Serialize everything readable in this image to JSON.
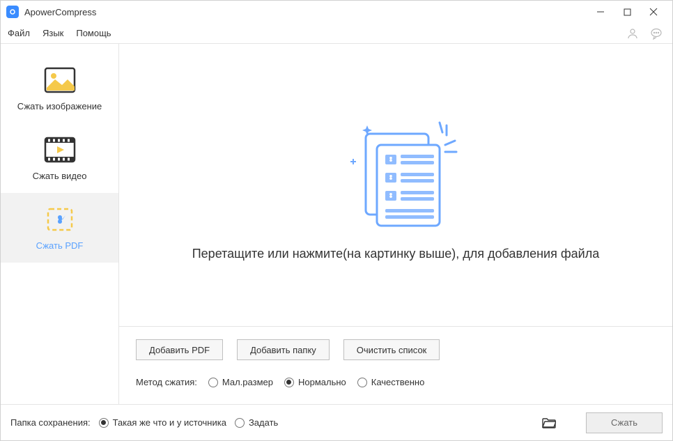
{
  "app": {
    "title": "ApowerCompress"
  },
  "menu": {
    "file": "Файл",
    "language": "Язык",
    "help": "Помощь"
  },
  "sidebar": {
    "items": [
      {
        "label": "Сжать изображение"
      },
      {
        "label": "Сжать видео"
      },
      {
        "label": "Сжать PDF"
      }
    ],
    "activeIndex": 2
  },
  "drop": {
    "text": "Перетащите или нажмите(на картинку выше), для добавления файла"
  },
  "buttons": {
    "addPdf": "Добавить PDF",
    "addFolder": "Добавить папку",
    "clear": "Очистить список"
  },
  "method": {
    "label": "Метод сжатия:",
    "options": [
      {
        "label": "Мал.размер",
        "selected": false
      },
      {
        "label": "Нормально",
        "selected": true
      },
      {
        "label": "Качественно",
        "selected": false
      }
    ]
  },
  "footer": {
    "saveFolderLabel": "Папка сохранения:",
    "options": [
      {
        "label": "Такая же что и у источника",
        "selected": true
      },
      {
        "label": "Задать",
        "selected": false
      }
    ],
    "compress": "Сжать"
  }
}
